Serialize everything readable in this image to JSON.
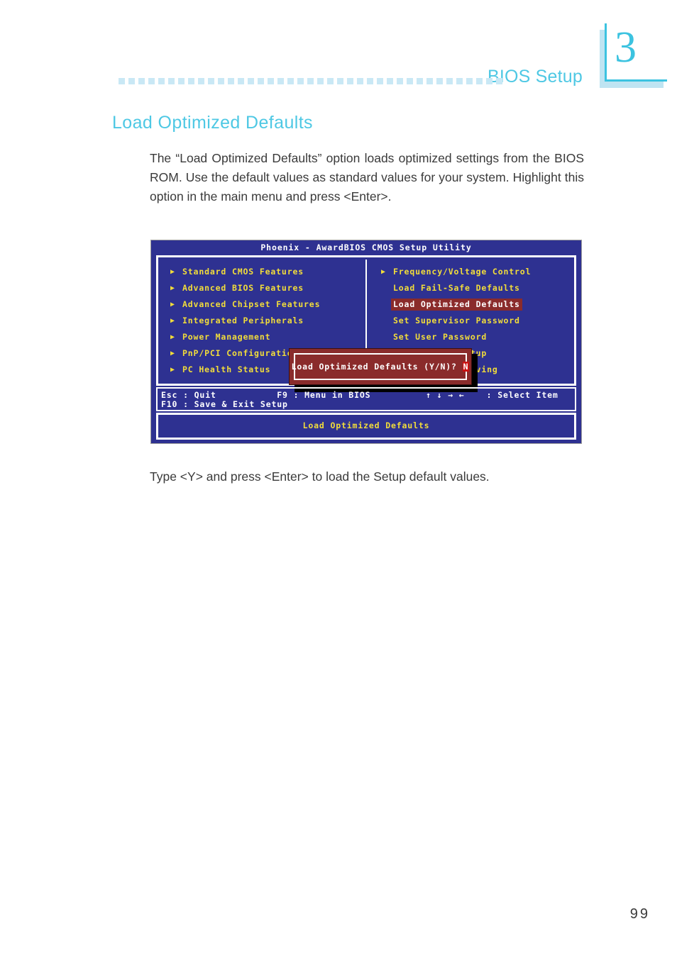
{
  "header": {
    "chapter_number": "3",
    "title": "BIOS Setup",
    "dot_count": 39,
    "accent_color": "#4ec8e4",
    "dot_color": "#c9e8f5"
  },
  "section": {
    "title": "Load Optimized Defaults",
    "intro_paragraph": "The “Load Optimized Defaults” option loads optimized settings from the BIOS ROM. Use the default values as standard values for your system. Highlight this option in the main menu and press <Enter>.",
    "outro_paragraph": "Type <Y> and press <Enter> to load the Setup default values."
  },
  "bios": {
    "title_bar": "Phoenix - AwardBIOS CMOS Setup Utility",
    "background_color": "#2e3191",
    "menu_text_color": "#f2dd3a",
    "highlight_color": "#8a2b2b",
    "left_menu": [
      {
        "label": "Standard CMOS Features",
        "arrow": true,
        "selected": false
      },
      {
        "label": "Advanced BIOS Features",
        "arrow": true,
        "selected": false
      },
      {
        "label": "Advanced Chipset Features",
        "arrow": true,
        "selected": false
      },
      {
        "label": "Integrated Peripherals",
        "arrow": true,
        "selected": false
      },
      {
        "label": "Power Management",
        "arrow": true,
        "selected": false
      },
      {
        "label": "PnP/PCI Configurations",
        "arrow": true,
        "selected": false
      },
      {
        "label": "PC Health Status",
        "arrow": true,
        "selected": false
      }
    ],
    "right_menu": [
      {
        "label": "Frequency/Voltage Control",
        "arrow": true,
        "selected": false
      },
      {
        "label": "Load Fail-Safe Defaults",
        "arrow": false,
        "selected": false
      },
      {
        "label": "Load Optimized Defaults",
        "arrow": false,
        "selected": true
      },
      {
        "label": "Set Supervisor Password",
        "arrow": false,
        "selected": false
      },
      {
        "label": "Set User Password",
        "arrow": false,
        "selected": false
      },
      {
        "label": "Save & Exit Setup",
        "arrow": false,
        "selected": false
      },
      {
        "label": "Exit Without Saving",
        "arrow": false,
        "selected": false
      }
    ],
    "key_help_line1": "Esc : Quit           F9 : Menu in BIOS          ↑ ↓ → ←    : Select Item",
    "key_help_line2": "F10 : Save & Exit Setup",
    "status_message": "Load Optimized Defaults",
    "dialog": {
      "prompt": "Load Optimized Defaults (Y/N)? ",
      "answer": "N",
      "background_color": "#8a2b2b",
      "answer_highlight_color": "#cc1111"
    }
  },
  "footer": {
    "page_number": "99"
  }
}
